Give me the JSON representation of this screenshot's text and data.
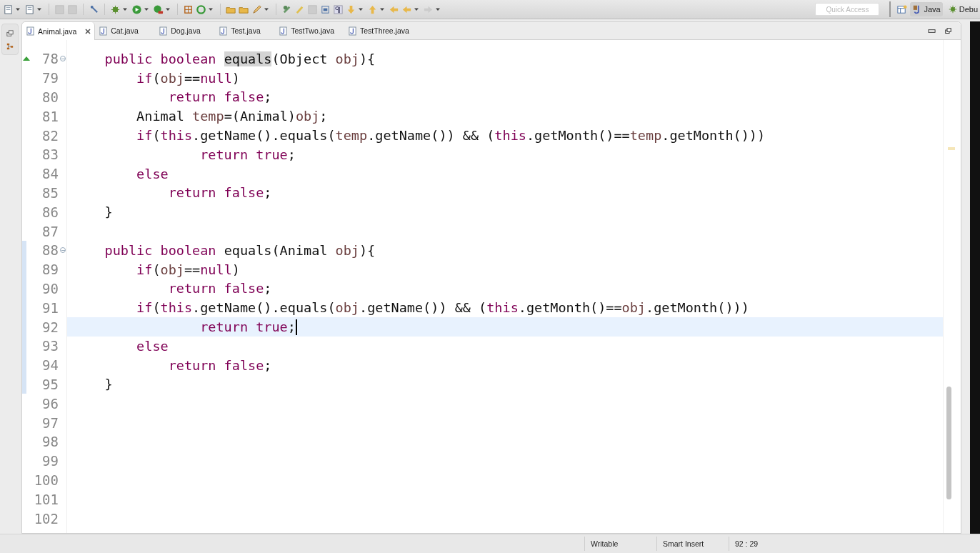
{
  "toolbar": {
    "quick_access": {
      "placeholder": "Quick Access"
    },
    "perspectives": [
      {
        "label": "Java",
        "selected": true
      },
      {
        "label": "Debu",
        "selected": false
      }
    ]
  },
  "tabs": [
    {
      "label": "Animal.java",
      "selected": true
    },
    {
      "label": "Cat.java",
      "selected": false
    },
    {
      "label": "Dog.java",
      "selected": false
    },
    {
      "label": "Test.java",
      "selected": false
    },
    {
      "label": "TestTwo.java",
      "selected": false
    },
    {
      "label": "TestThree.java",
      "selected": false
    }
  ],
  "editor": {
    "lines": [
      {
        "number": "78",
        "fold": true,
        "tokens": [
          {
            "text": "    public boolean ",
            "kind": "keyword"
          },
          {
            "text": "equals",
            "kind": "occurrence"
          },
          {
            "text": "(Object "
          },
          {
            "text": "obj",
            "kind": "variable"
          },
          {
            "text": "){"
          }
        ]
      },
      {
        "number": "79",
        "tokens": [
          {
            "text": "        if",
            "kind": "keyword"
          },
          {
            "text": "("
          },
          {
            "text": "obj",
            "kind": "variable"
          },
          {
            "text": "=="
          },
          {
            "text": "null",
            "kind": "keyword"
          },
          {
            "text": ")"
          }
        ]
      },
      {
        "number": "80",
        "tokens": [
          {
            "text": "            return false",
            "kind": "keyword"
          },
          {
            "text": ";"
          }
        ]
      },
      {
        "number": "81",
        "tokens": [
          {
            "text": "        Animal "
          },
          {
            "text": "temp",
            "kind": "variable"
          },
          {
            "text": "=(Animal)"
          },
          {
            "text": "obj",
            "kind": "variable"
          },
          {
            "text": ";"
          }
        ]
      },
      {
        "number": "82",
        "tokens": [
          {
            "text": "        if",
            "kind": "keyword"
          },
          {
            "text": "("
          },
          {
            "text": "this",
            "kind": "keyword"
          },
          {
            "text": ".getName().equals("
          },
          {
            "text": "temp",
            "kind": "variable"
          },
          {
            "text": ".getName()) && ("
          },
          {
            "text": "this",
            "kind": "keyword"
          },
          {
            "text": ".getMonth()=="
          },
          {
            "text": "temp",
            "kind": "variable"
          },
          {
            "text": ".getMonth()))"
          }
        ]
      },
      {
        "number": "83",
        "tokens": [
          {
            "text": "                return true",
            "kind": "keyword"
          },
          {
            "text": ";"
          }
        ]
      },
      {
        "number": "84",
        "tokens": [
          {
            "text": "        else",
            "kind": "keyword"
          }
        ]
      },
      {
        "number": "85",
        "tokens": [
          {
            "text": "            return false",
            "kind": "keyword"
          },
          {
            "text": ";"
          }
        ]
      },
      {
        "number": "86",
        "tokens": [
          {
            "text": "    }"
          }
        ]
      },
      {
        "number": "87"
      },
      {
        "number": "88",
        "fold": true,
        "changed": true,
        "tokens": [
          {
            "text": "    public boolean ",
            "kind": "keyword"
          },
          {
            "text": "equals(Animal "
          },
          {
            "text": "obj",
            "kind": "variable"
          },
          {
            "text": "){"
          }
        ]
      },
      {
        "number": "89",
        "changed": true,
        "tokens": [
          {
            "text": "        if",
            "kind": "keyword"
          },
          {
            "text": "("
          },
          {
            "text": "obj",
            "kind": "variable"
          },
          {
            "text": "=="
          },
          {
            "text": "null",
            "kind": "keyword"
          },
          {
            "text": ")"
          }
        ]
      },
      {
        "number": "90",
        "changed": true,
        "tokens": [
          {
            "text": "            return false",
            "kind": "keyword"
          },
          {
            "text": ";"
          }
        ]
      },
      {
        "number": "91",
        "changed": true,
        "tokens": [
          {
            "text": "        if",
            "kind": "keyword"
          },
          {
            "text": "("
          },
          {
            "text": "this",
            "kind": "keyword"
          },
          {
            "text": ".getName().equals("
          },
          {
            "text": "obj",
            "kind": "variable"
          },
          {
            "text": ".getName()) && ("
          },
          {
            "text": "this",
            "kind": "keyword"
          },
          {
            "text": ".getMonth()=="
          },
          {
            "text": "obj",
            "kind": "variable"
          },
          {
            "text": ".getMonth()))"
          }
        ]
      },
      {
        "number": "92",
        "changed": true,
        "current": true,
        "tokens": [
          {
            "text": "                return true",
            "kind": "keyword"
          },
          {
            "text": ";"
          }
        ]
      },
      {
        "number": "93",
        "changed": true,
        "tokens": [
          {
            "text": "        else",
            "kind": "keyword"
          }
        ]
      },
      {
        "number": "94",
        "changed": true,
        "tokens": [
          {
            "text": "            return false",
            "kind": "keyword"
          },
          {
            "text": ";"
          }
        ]
      },
      {
        "number": "95",
        "changed": true,
        "tokens": [
          {
            "text": "    }"
          }
        ]
      },
      {
        "number": "96"
      },
      {
        "number": "97"
      },
      {
        "number": "98"
      },
      {
        "number": "99"
      },
      {
        "number": "100"
      },
      {
        "number": "101"
      },
      {
        "number": "102"
      }
    ]
  },
  "status_bar": [
    "Writable",
    "Smart Insert",
    "92 : 29"
  ]
}
